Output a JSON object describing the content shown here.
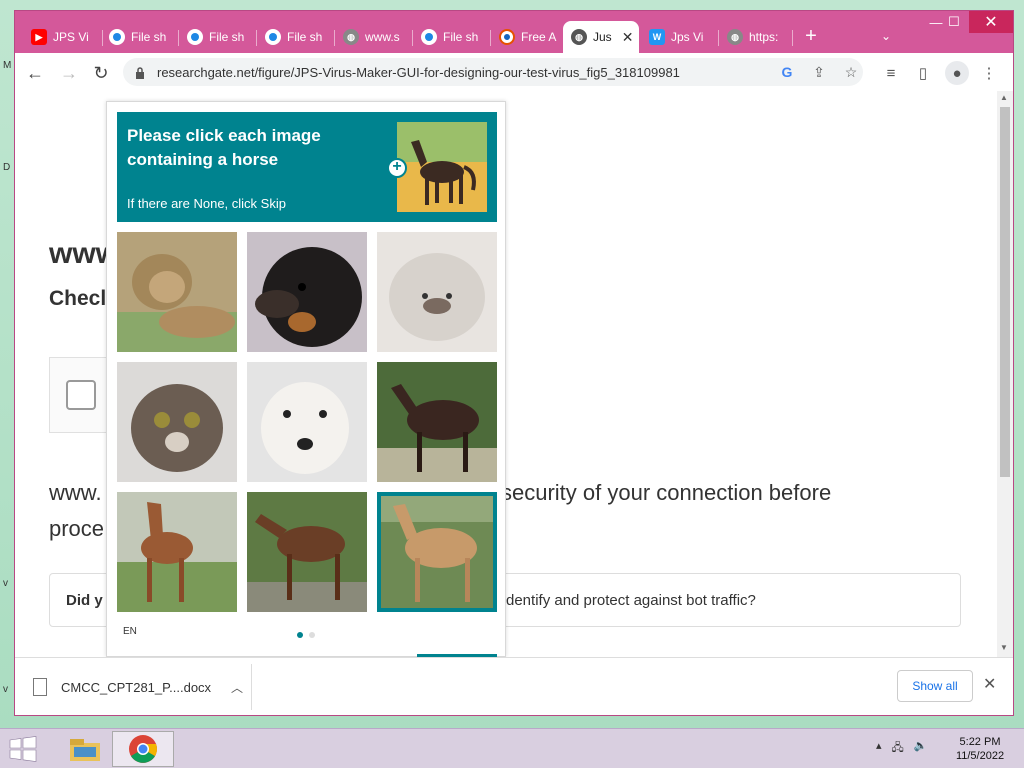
{
  "window": {
    "tabs": [
      {
        "label": "JPS Vi",
        "icon": "youtube-icon",
        "color": "#ff0000"
      },
      {
        "label": "File sh",
        "icon": "fileshare-icon",
        "color": "#1e88e5"
      },
      {
        "label": "File sh",
        "icon": "fileshare-icon",
        "color": "#1e88e5"
      },
      {
        "label": "File sh",
        "icon": "fileshare-icon",
        "color": "#1e88e5"
      },
      {
        "label": "www.s",
        "icon": "globe-icon",
        "color": "#777777"
      },
      {
        "label": "File sh",
        "icon": "fileshare-icon",
        "color": "#1e88e5"
      },
      {
        "label": "Free A",
        "icon": "freeav-icon",
        "color": "#e65100"
      },
      {
        "label": "Jus",
        "icon": "globe-icon",
        "color": "#555555",
        "active": true
      },
      {
        "label": "Jps Vi",
        "icon": "w-icon",
        "color": "#2196f3"
      },
      {
        "label": "https:",
        "icon": "globe-icon",
        "color": "#777777"
      }
    ],
    "new_tab": "+",
    "minimize": "—",
    "maximize": "☐",
    "close": "✕"
  },
  "toolbar": {
    "back": "←",
    "forward": "→",
    "reload": "↻",
    "url": "researchgate.net/figure/JPS-Virus-Maker-GUI-for-designing-our-test-virus_fig5_318109981"
  },
  "page": {
    "title": "www",
    "subtitle": "Checl",
    "check_text_1_left": "www.",
    "check_text_1_right": "security of your connection before",
    "check_text_2": "proce",
    "faq_left": "Did y",
    "faq_right": "dentify and protect against bot traffic?"
  },
  "captcha": {
    "prompt": "Please click each image containing a horse",
    "hint": "If there are None, click Skip",
    "language": "EN",
    "tiles": [
      {
        "subject": "lion",
        "selected": false
      },
      {
        "subject": "dog-black-tan",
        "selected": false
      },
      {
        "subject": "persian-cat",
        "selected": false
      },
      {
        "subject": "kitten",
        "selected": false
      },
      {
        "subject": "white-dog",
        "selected": false
      },
      {
        "subject": "horse-dark",
        "selected": false
      },
      {
        "subject": "foal-chestnut",
        "selected": false
      },
      {
        "subject": "horse-brown",
        "selected": false
      },
      {
        "subject": "horse-palomino",
        "selected": true
      }
    ],
    "page_dots": 2,
    "current_page": 1,
    "accent": "#00838f"
  },
  "downloads": {
    "file_name": "CMCC_CPT281_P....docx",
    "show_all": "Show all",
    "close": "✕"
  },
  "taskbar": {
    "time": "5:22 PM",
    "date": "11/5/2022"
  }
}
